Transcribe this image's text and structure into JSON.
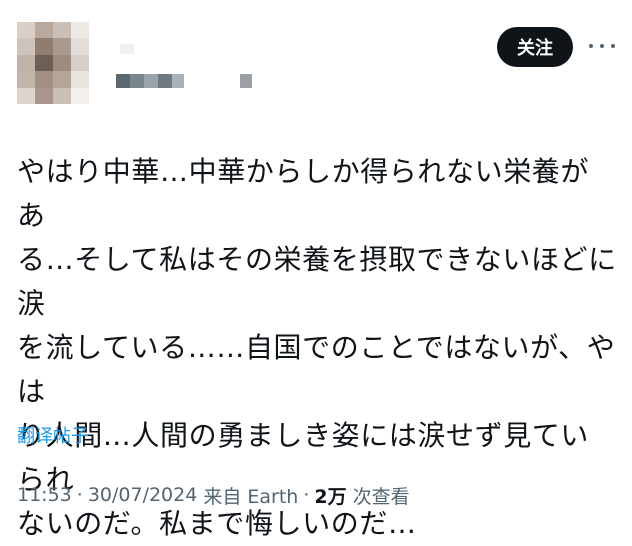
{
  "header": {
    "follow_label": "关注",
    "avatar_mosaic_colors": [
      "#d9cfc7",
      "#b9a99c",
      "#c9bfb6",
      "#ede9e5",
      "#cfc4bb",
      "#8f7d70",
      "#a89a8e",
      "#e2ddd8",
      "#bfb2a7",
      "#6e5f55",
      "#9c8b7e",
      "#d6cfc9",
      "#c2b5aa",
      "#a39082",
      "#b5a598",
      "#e8e4e0",
      "#ddd4cc",
      "#a8968a",
      "#cbbfb5",
      "#f2efec"
    ],
    "handle_pixel_colors": [
      "#5b6870",
      "#7a858c",
      "#9aa3a9",
      "#6f7a81",
      "#aab2b7"
    ],
    "icons": {
      "more": "more-horizontal-icon"
    }
  },
  "tweet": {
    "text": "やはり中華…中華からしか得られない栄養があ\nる…そして私はその栄養を摂取できないほどに涙\nを流している……自国でのことではないが、やは\nり人間…人間の勇ましき姿には涙せず見ていられ\nないのだ。私まで悔しいのだ…",
    "translate_label": "翻译帖子"
  },
  "meta": {
    "time": "11:53",
    "date": "30/07/2024",
    "source": "来自 Earth",
    "views_count": "2万",
    "views_label": "次查看",
    "separator": "·"
  },
  "colors": {
    "text": "#0f1419",
    "secondary": "#536471",
    "link": "#1d9bf0",
    "button_bg": "#0f1419",
    "button_text": "#ffffff"
  }
}
